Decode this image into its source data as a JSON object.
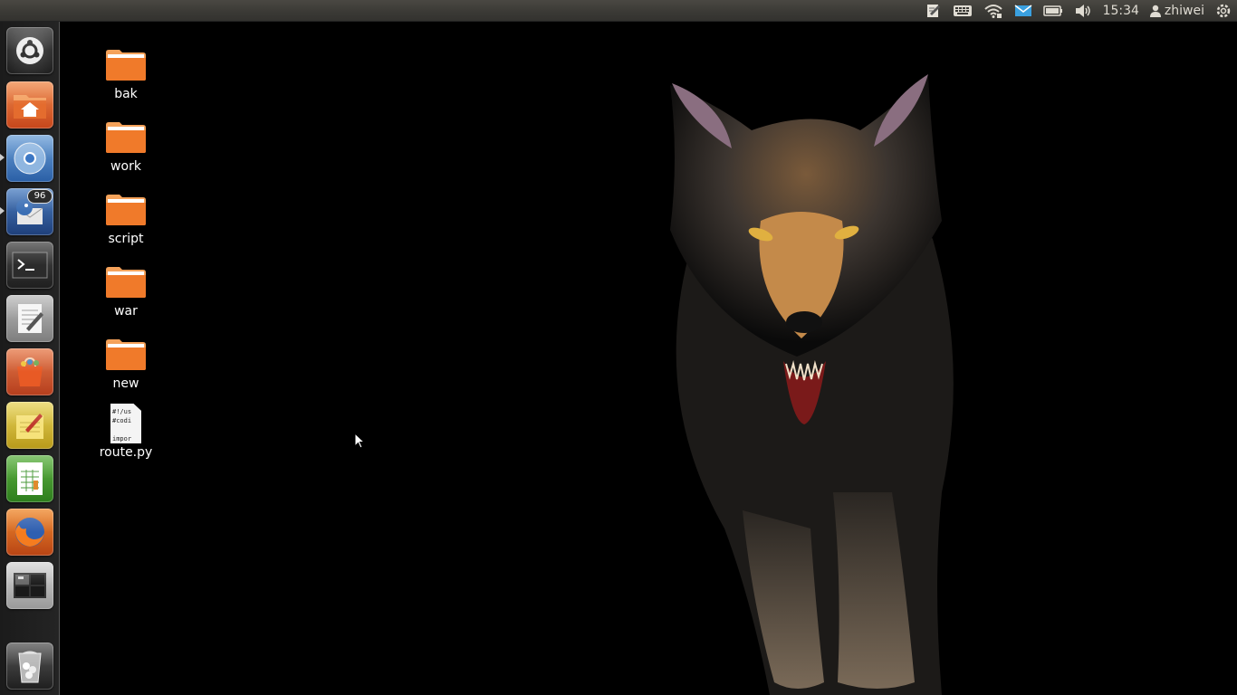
{
  "panel": {
    "clock": "15:34",
    "username": "zhiwei",
    "indicators": [
      "notes-icon",
      "keyboard-icon",
      "wifi-icon",
      "mail-icon",
      "battery-icon",
      "volume-icon"
    ]
  },
  "launcher": {
    "items": [
      {
        "name": "dash-button",
        "icon": "ubuntu-logo-icon"
      },
      {
        "name": "home-folder",
        "icon": "home-folder-icon"
      },
      {
        "name": "chromium-browser",
        "icon": "chromium-icon",
        "running": true
      },
      {
        "name": "thunderbird-mail",
        "icon": "thunderbird-icon",
        "running": true,
        "badge": "96"
      },
      {
        "name": "terminal",
        "icon": "terminal-icon"
      },
      {
        "name": "text-editor",
        "icon": "text-editor-icon"
      },
      {
        "name": "software-center",
        "icon": "software-center-icon"
      },
      {
        "name": "notes",
        "icon": "notepad-icon"
      },
      {
        "name": "spreadsheet",
        "icon": "spreadsheet-icon"
      },
      {
        "name": "firefox",
        "icon": "firefox-icon"
      },
      {
        "name": "workspace-switcher",
        "icon": "workspaces-icon"
      },
      {
        "name": "trash",
        "icon": "trash-icon"
      }
    ]
  },
  "desktop": {
    "icons": [
      {
        "label": "bak",
        "type": "folder"
      },
      {
        "label": "work",
        "type": "folder"
      },
      {
        "label": "script",
        "type": "folder"
      },
      {
        "label": "war",
        "type": "folder"
      },
      {
        "label": "new",
        "type": "folder"
      },
      {
        "label": "route.py",
        "type": "file",
        "preview": [
          "#!/us",
          "#codi",
          "impor"
        ]
      }
    ]
  },
  "colors": {
    "panel": "#3c3b37",
    "launcher": "#1f1f1f",
    "folder": "#f08a36",
    "desktop": "#000000"
  }
}
